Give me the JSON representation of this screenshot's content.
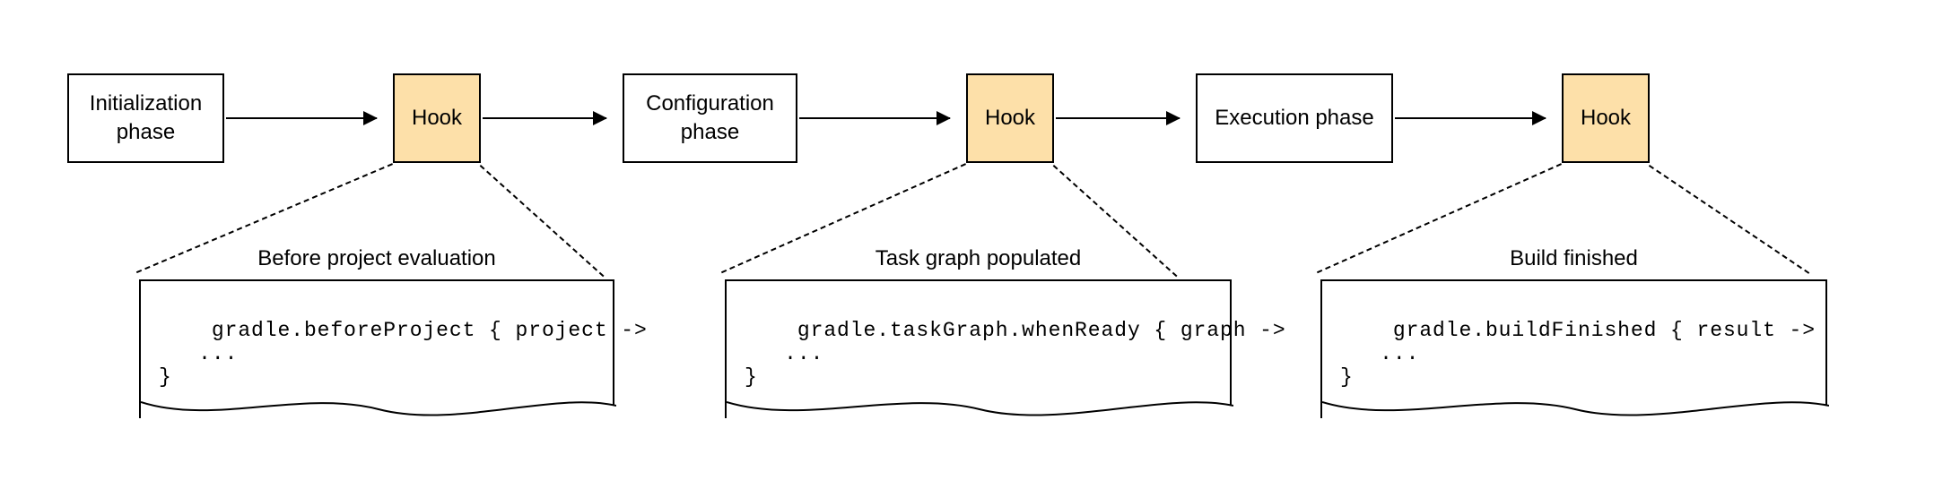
{
  "boxes": {
    "init_phase": "Initialization\nphase",
    "hook1": "Hook",
    "config_phase": "Configuration\nphase",
    "hook2": "Hook",
    "exec_phase": "Execution phase",
    "hook3": "Hook"
  },
  "callouts": {
    "c1": {
      "title": "Before project evaluation",
      "code": "gradle.beforeProject { project ->\n   ...\n}"
    },
    "c2": {
      "title": "Task graph populated",
      "code": "gradle.taskGraph.whenReady { graph ->\n   ...\n}"
    },
    "c3": {
      "title": "Build finished",
      "code": "gradle.buildFinished { result ->\n   ...\n}"
    }
  },
  "colors": {
    "hook_fill": "#fde0a9",
    "border": "#000000"
  }
}
